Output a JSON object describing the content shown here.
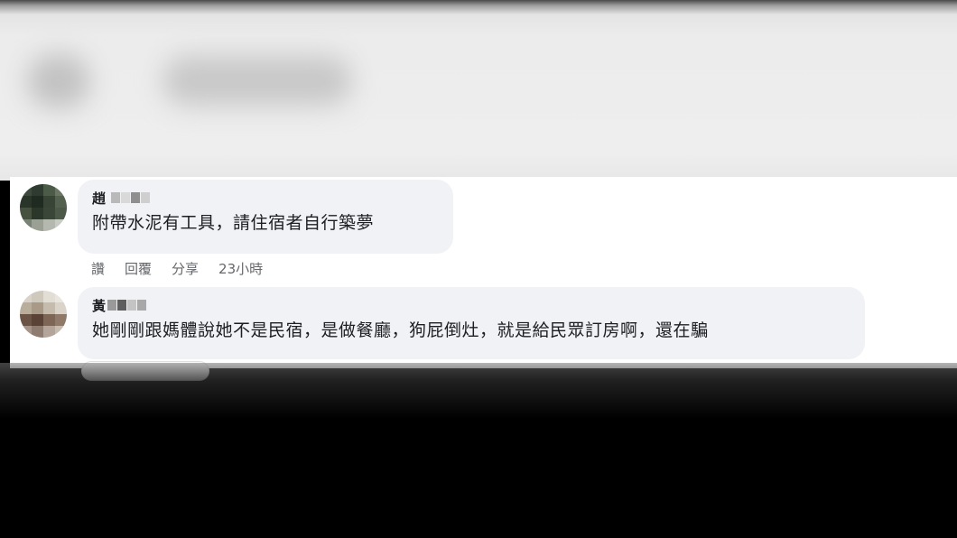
{
  "comments": [
    {
      "author_visible": "趙",
      "text": "附帶水泥有工具，請住宿者自行築夢",
      "actions": {
        "like": "讚",
        "reply": "回覆",
        "share": "分享",
        "time": "23小時"
      }
    },
    {
      "author_visible": "黃",
      "text": "她剛剛跟媽體說她不是民宿，是做餐廳，狗屁倒灶，就是給民眾訂房啊，還在騙"
    }
  ],
  "colors": {
    "bubble_bg": "#f0f2f5",
    "meta_text": "#65676b",
    "body_text": "#1c1e21"
  }
}
